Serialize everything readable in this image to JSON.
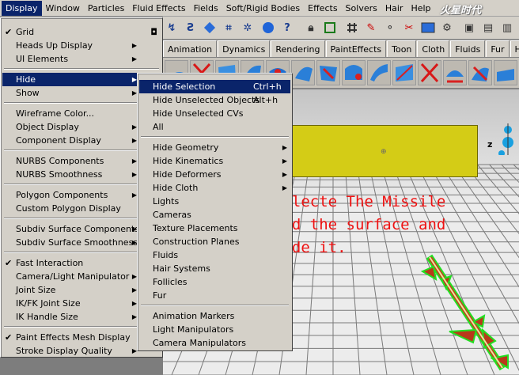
{
  "menubar": {
    "items": [
      "Display",
      "Window",
      "Particles",
      "Fluid Effects",
      "Fields",
      "Soft/Rigid Bodies",
      "Effects",
      "Solvers",
      "Hair",
      "Help"
    ]
  },
  "watermark": "火星时代",
  "shelf_tabs": [
    "Animation",
    "Dynamics",
    "Rendering",
    "PaintEffects",
    "Toon",
    "Cloth",
    "Fluids",
    "Fur",
    "Hair"
  ],
  "display_menu": {
    "grid": "Grid",
    "heads_up": "Heads Up Display",
    "ui_elements": "UI Elements",
    "hide": "Hide",
    "show": "Show",
    "wireframe_color": "Wireframe Color...",
    "object_display": "Object Display",
    "component_display": "Component Display",
    "nurbs_components": "NURBS Components",
    "nurbs_smoothness": "NURBS Smoothness",
    "polygon_components": "Polygon Components",
    "custom_polygon_display": "Custom Polygon Display",
    "subdiv_components": "Subdiv Surface Components",
    "subdiv_smoothness": "Subdiv Surface Smoothness",
    "fast_interaction": "Fast Interaction",
    "camera_light_manipulator": "Camera/Light Manipulator",
    "joint_size": "Joint Size",
    "ik_fk_joint_size": "IK/FK Joint Size",
    "ik_handle_size": "IK Handle Size",
    "paint_effects_mesh": "Paint Effects Mesh Display",
    "stroke_display_quality": "Stroke Display Quality"
  },
  "hide_menu": {
    "hide_selection": "Hide Selection",
    "hide_selection_shortcut": "Ctrl+h",
    "hide_unselected_objects": "Hide Unselected Objects",
    "hide_unselected_objects_shortcut": "Alt+h",
    "hide_unselected_cvs": "Hide Unselected CVs",
    "all": "All",
    "hide_geometry": "Hide Geometry",
    "hide_kinematics": "Hide Kinematics",
    "hide_deformers": "Hide Deformers",
    "hide_cloth": "Hide Cloth",
    "lights": "Lights",
    "cameras": "Cameras",
    "texture_placements": "Texture Placements",
    "construction_planes": "Construction Planes",
    "fluids": "Fluids",
    "hair_systems": "Hair Systems",
    "follicles": "Follicles",
    "fur": "Fur",
    "animation_markers": "Animation Markers",
    "light_manipulators": "Light Manipulators",
    "camera_manipulators": "Camera Manipulators"
  },
  "annotation": {
    "line1": "Selecte The Missile",
    "line2": "And the surface and",
    "line3": "Hide it."
  },
  "viewport": {
    "axis_z": "z"
  },
  "colors": {
    "menu_highlight": "#0a246a",
    "menu_bg": "#d4d0c8",
    "annotation": "#ee1111",
    "plane": "#d4cc16",
    "missile_wire": "#22e022"
  }
}
